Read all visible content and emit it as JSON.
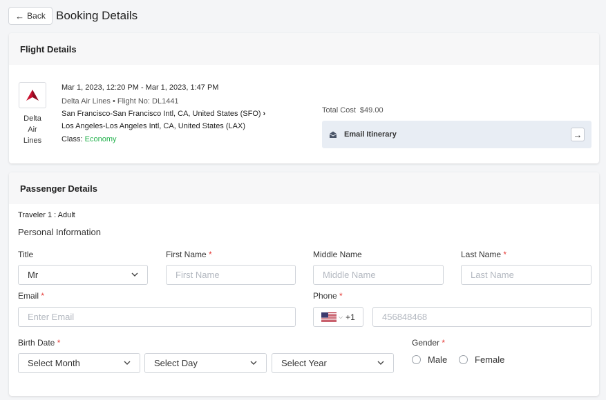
{
  "header": {
    "back_label": "Back",
    "title": "Booking Details"
  },
  "flight": {
    "section_title": "Flight Details",
    "airline_name": "Delta Air Lines",
    "datetime": "Mar 1, 2023, 12:20 PM - Mar 1, 2023, 1:47 PM",
    "airline_flight": "Delta Air Lines • Flight No: DL1441",
    "origin": "San Francisco-San Francisco Intl, CA, United States (SFO)",
    "destination": "Los Angeles-Los Angeles Intl, CA, United States (LAX)",
    "class_label": "Class:",
    "class_value": "Economy",
    "total_cost_label": "Total Cost",
    "total_cost_value": "$49.00",
    "email_itinerary_label": "Email Itinerary",
    "colors": {
      "delta_red": "#c8102e",
      "economy_green": "#22b14c"
    }
  },
  "passenger": {
    "section_title": "Passenger Details",
    "traveler": "Traveler 1 : Adult",
    "personal_info": "Personal Information",
    "title_label": "Title",
    "title_value": "Mr",
    "first_name_label": "First Name",
    "first_name_placeholder": "First Name",
    "middle_name_label": "Middle Name",
    "middle_name_placeholder": "Middle Name",
    "last_name_label": "Last Name",
    "last_name_placeholder": "Last Name",
    "email_label": "Email",
    "email_placeholder": "Enter Email",
    "phone_label": "Phone",
    "phone_code": "+1",
    "phone_placeholder": "456848468",
    "birth_date_label": "Birth Date",
    "month_value": "Select Month",
    "day_value": "Select Day",
    "year_value": "Select Year",
    "gender_label": "Gender",
    "gender_male": "Male",
    "gender_female": "Female",
    "required_mark": "*"
  }
}
